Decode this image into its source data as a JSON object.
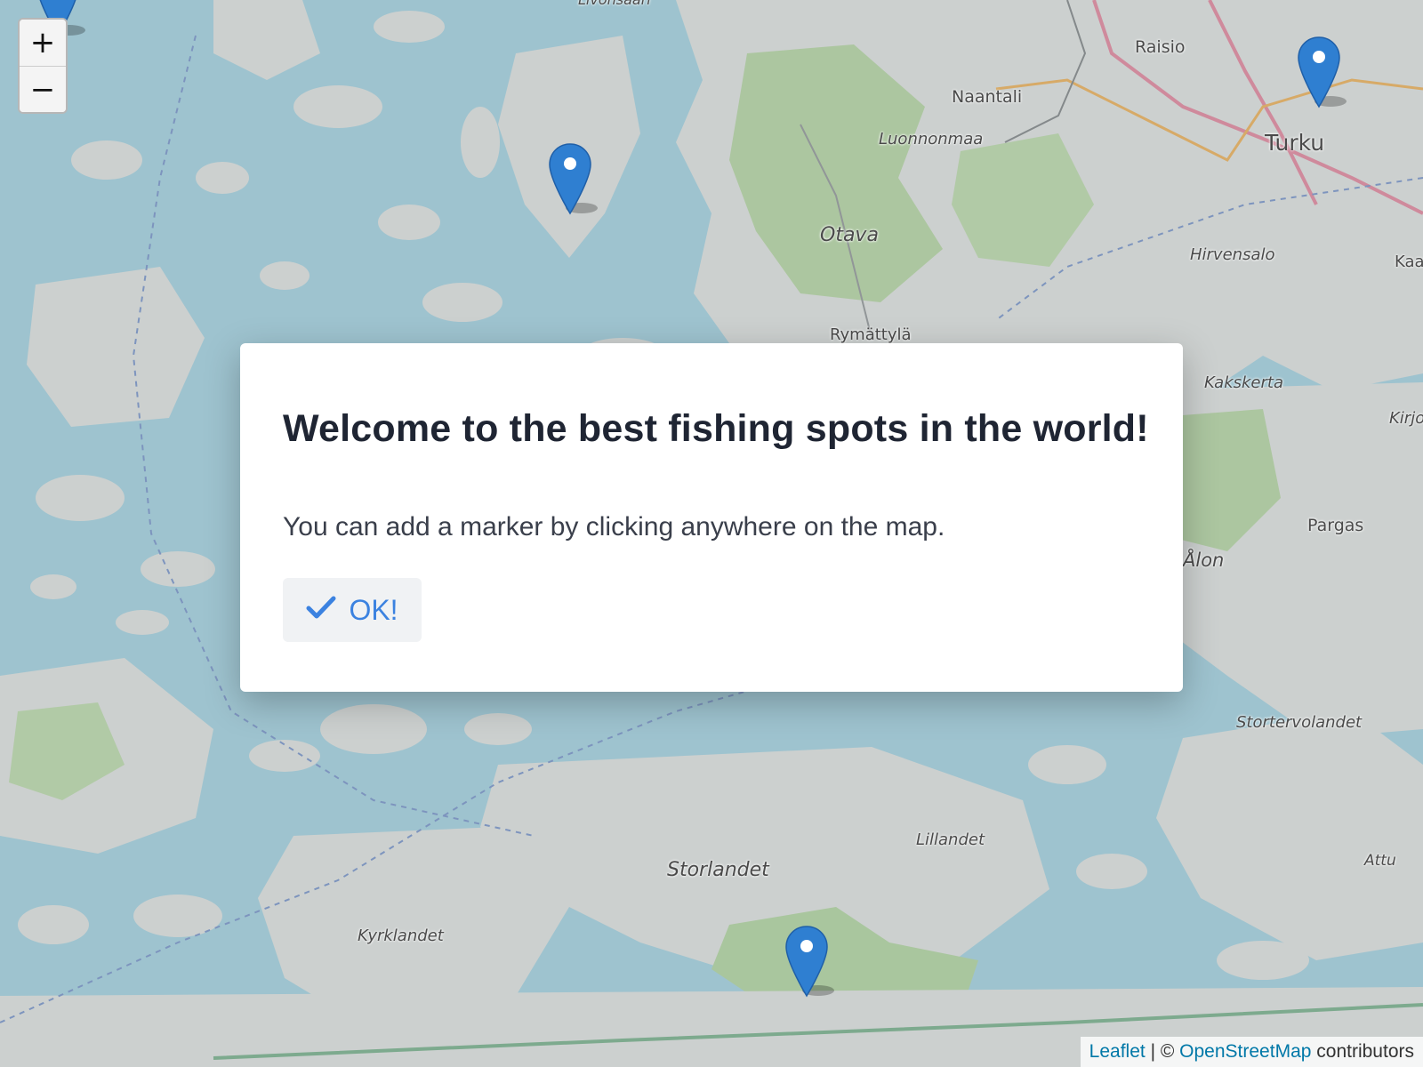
{
  "map": {
    "zoom_in_label": "+",
    "zoom_out_label": "−",
    "labels": [
      {
        "text": "Raisio",
        "italic": false
      },
      {
        "text": "Naantali",
        "italic": false
      },
      {
        "text": "Luonnonmaa",
        "italic": true
      },
      {
        "text": "Turku",
        "italic": false
      },
      {
        "text": "Otava",
        "italic": true
      },
      {
        "text": "Hirvensalo",
        "italic": true
      },
      {
        "text": "Kaa",
        "italic": false
      },
      {
        "text": "Rymättylä",
        "italic": false
      },
      {
        "text": "Kakskerta",
        "italic": true
      },
      {
        "text": "Kirjo",
        "italic": true
      },
      {
        "text": "Pargas",
        "italic": false
      },
      {
        "text": "Ålon",
        "italic": true
      },
      {
        "text": "Stortervolandet",
        "italic": true
      },
      {
        "text": "Lillandet",
        "italic": true
      },
      {
        "text": "Storlandet",
        "italic": true
      },
      {
        "text": "Attu",
        "italic": true
      },
      {
        "text": "Kyrklandet",
        "italic": true
      },
      {
        "text": "Livonsaari",
        "italic": true
      }
    ],
    "markers": [
      "marker",
      "marker",
      "marker",
      "marker"
    ],
    "colors": {
      "water": "#aad3df",
      "land": "#e2e2e0",
      "forest": "#b8d6a0",
      "marker": "#2f7fd1"
    }
  },
  "attribution": {
    "leaflet": "Leaflet",
    "separator": " | © ",
    "osm": "OpenStreetMap",
    "suffix": " contributors"
  },
  "modal": {
    "title": "Welcome to the best fishing spots in the world!",
    "body": "You can add a marker by clicking anywhere on the map.",
    "ok_label": "OK!",
    "accent": "#3b82e0"
  }
}
